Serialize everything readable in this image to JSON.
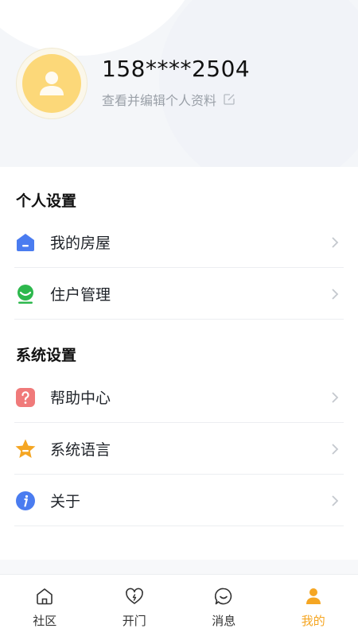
{
  "profile": {
    "phone": "158****2504",
    "edit_link": "查看并编辑个人资料"
  },
  "sections": [
    {
      "title": "个人设置",
      "items": [
        {
          "label": "我的房屋",
          "icon": "house-icon",
          "color": "#4a7cf0"
        },
        {
          "label": "住户管理",
          "icon": "resident-icon",
          "color": "#2db84d"
        }
      ]
    },
    {
      "title": "系统设置",
      "items": [
        {
          "label": "帮助中心",
          "icon": "help-icon",
          "color": "#f07a7a"
        },
        {
          "label": "系统语言",
          "icon": "star-icon",
          "color": "#f5a623"
        },
        {
          "label": "关于",
          "icon": "info-icon",
          "color": "#4a7cf0"
        }
      ]
    }
  ],
  "tabbar": {
    "active_color": "#f5a623",
    "tabs": [
      {
        "label": "社区",
        "icon": "home-icon"
      },
      {
        "label": "开门",
        "icon": "heart-icon"
      },
      {
        "label": "消息",
        "icon": "message-icon"
      },
      {
        "label": "我的",
        "icon": "user-icon",
        "active": true
      }
    ]
  }
}
